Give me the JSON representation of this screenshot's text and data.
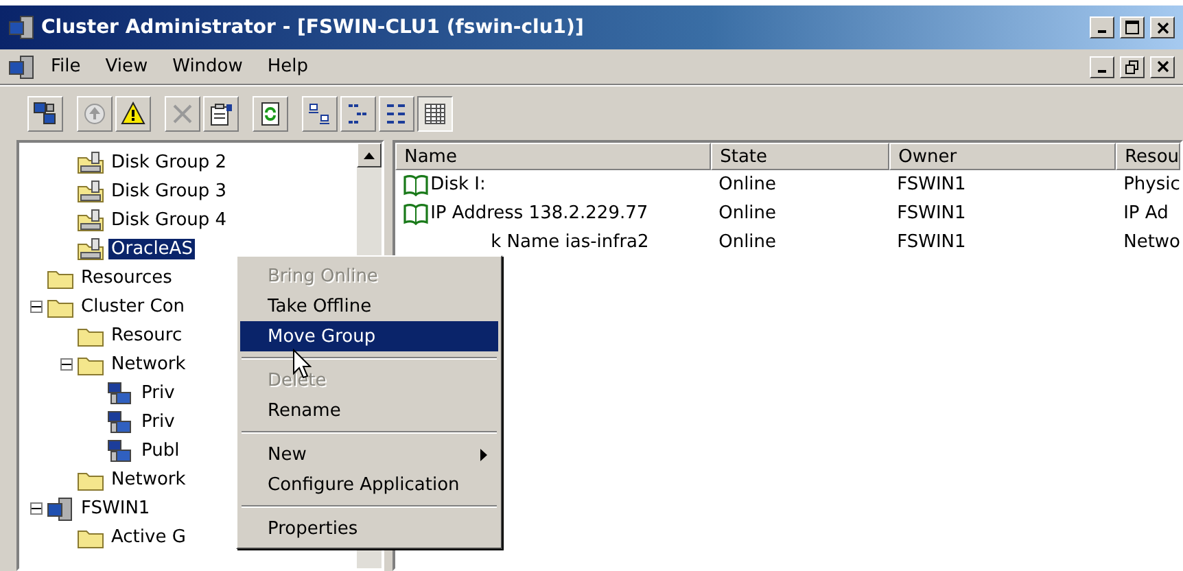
{
  "window": {
    "title": "Cluster Administrator - [FSWIN-CLU1 (fswin-clu1)]"
  },
  "menu_bar": [
    "File",
    "View",
    "Window",
    "Help"
  ],
  "toolbar": [
    {
      "kind": "cluster",
      "pressed": false
    },
    {
      "kind": "online",
      "pressed": false
    },
    {
      "kind": "warning",
      "pressed": false
    },
    {
      "kind": "delete",
      "pressed": false
    },
    {
      "kind": "properties",
      "pressed": false
    },
    {
      "kind": "refresh",
      "pressed": false
    },
    {
      "kind": "large-icons",
      "pressed": false
    },
    {
      "kind": "small-icons",
      "pressed": false
    },
    {
      "kind": "list",
      "pressed": false
    },
    {
      "kind": "details",
      "pressed": true
    }
  ],
  "tree": [
    {
      "children": [
        {
          "label": "Disk Group 2",
          "kind": "group",
          "selected": false
        },
        {
          "label": "Disk Group 3",
          "kind": "group",
          "selected": false
        },
        {
          "label": "Disk Group 4",
          "kind": "group",
          "selected": false
        },
        {
          "label": "OracleAS",
          "kind": "group",
          "selected": true
        }
      ]
    },
    {
      "label": "Resources",
      "kind": "folder",
      "selected": false
    },
    {
      "label": "Cluster Con",
      "kind": "folder",
      "selected": false,
      "expanded": true,
      "children": [
        {
          "label": "Resourc",
          "kind": "folder",
          "selected": false
        },
        {
          "label": "Network",
          "kind": "folder",
          "selected": false,
          "expanded": true,
          "children": [
            {
              "label": "Priv",
              "kind": "network",
              "selected": false
            },
            {
              "label": "Priv",
              "kind": "network",
              "selected": false
            },
            {
              "label": "Publ",
              "kind": "network",
              "selected": false
            }
          ]
        },
        {
          "label": "Network",
          "kind": "folder",
          "selected": false
        }
      ]
    },
    {
      "label": "FSWIN1",
      "kind": "node",
      "selected": false,
      "expanded": true,
      "children": [
        {
          "label": "Active G",
          "kind": "folder",
          "selected": false
        }
      ]
    }
  ],
  "table": {
    "columns": [
      "Name",
      "State",
      "Owner",
      "Resou"
    ],
    "rows": [
      {
        "cells": [
          "Disk I:",
          "Online",
          "FSWIN1",
          "Physic"
        ],
        "partly_covered": false
      },
      {
        "cells": [
          "IP Address 138.2.229.77",
          "Online",
          "FSWIN1",
          "IP Ad"
        ],
        "partly_covered": false
      },
      {
        "cells": [
          "k Name ias-infra2",
          "Online",
          "FSWIN1",
          "Netwo"
        ],
        "partly_covered": true
      }
    ]
  },
  "context_menu": [
    {
      "kind": "item",
      "label": "Bring Online",
      "disabled": true,
      "selected": false
    },
    {
      "kind": "item",
      "label": "Take Offline",
      "disabled": false,
      "selected": false
    },
    {
      "kind": "item",
      "label": "Move Group",
      "disabled": false,
      "selected": true
    },
    {
      "kind": "separator"
    },
    {
      "kind": "item",
      "label": "Delete",
      "disabled": true,
      "selected": false
    },
    {
      "kind": "item",
      "label": "Rename",
      "disabled": false,
      "selected": false
    },
    {
      "kind": "separator"
    },
    {
      "kind": "submenu",
      "label": "New",
      "disabled": false,
      "selected": false
    },
    {
      "kind": "item",
      "label": "Configure Application",
      "disabled": false,
      "selected": false
    },
    {
      "kind": "separator"
    },
    {
      "kind": "item",
      "label": "Properties",
      "disabled": false,
      "selected": false
    }
  ]
}
